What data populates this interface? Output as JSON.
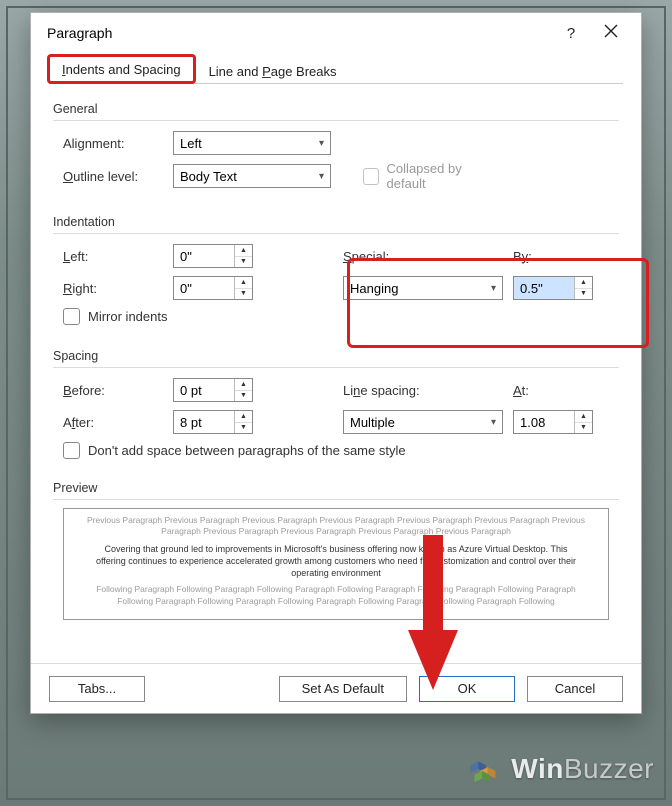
{
  "dialog": {
    "title": "Paragraph",
    "help": "?"
  },
  "tabs": {
    "indents": "Indents and Spacing",
    "breaks": "Line and Page Breaks"
  },
  "general": {
    "group": "General",
    "alignment_label": "Alignment:",
    "alignment_value": "Left",
    "outline_label": "Outline level:",
    "outline_value": "Body Text",
    "collapsed_label": "Collapsed by default"
  },
  "indent": {
    "group": "Indentation",
    "left_label": "Left:",
    "left_value": "0\"",
    "right_label": "Right:",
    "right_value": "0\"",
    "special_label": "Special:",
    "special_value": "Hanging",
    "by_label": "By:",
    "by_value": "0.5\"",
    "mirror_label": "Mirror indents"
  },
  "spacing": {
    "group": "Spacing",
    "before_label": "Before:",
    "before_value": "0 pt",
    "after_label": "After:",
    "after_value": "8 pt",
    "line_label": "Line spacing:",
    "line_value": "Multiple",
    "at_label": "At:",
    "at_value": "1.08",
    "noadd_label": "Don't add space between paragraphs of the same style"
  },
  "preview": {
    "group": "Preview",
    "prev_text": "Previous Paragraph Previous Paragraph Previous Paragraph Previous Paragraph Previous Paragraph Previous Paragraph Previous Paragraph Previous Paragraph Previous Paragraph Previous Paragraph Previous Paragraph",
    "sample_text": "Covering that ground led to improvements in Microsoft's business offering now known as Azure Virtual Desktop. This offering continues to experience accelerated growth among customers who need full customization and control over their operating environment",
    "next_text": "Following Paragraph Following Paragraph Following Paragraph Following Paragraph Following Paragraph Following Paragraph Following Paragraph Following Paragraph Following Paragraph Following Paragraph Following Paragraph Following"
  },
  "buttons": {
    "tabs": "Tabs...",
    "default": "Set As Default",
    "ok": "OK",
    "cancel": "Cancel"
  },
  "watermark": "WinBuzzer"
}
